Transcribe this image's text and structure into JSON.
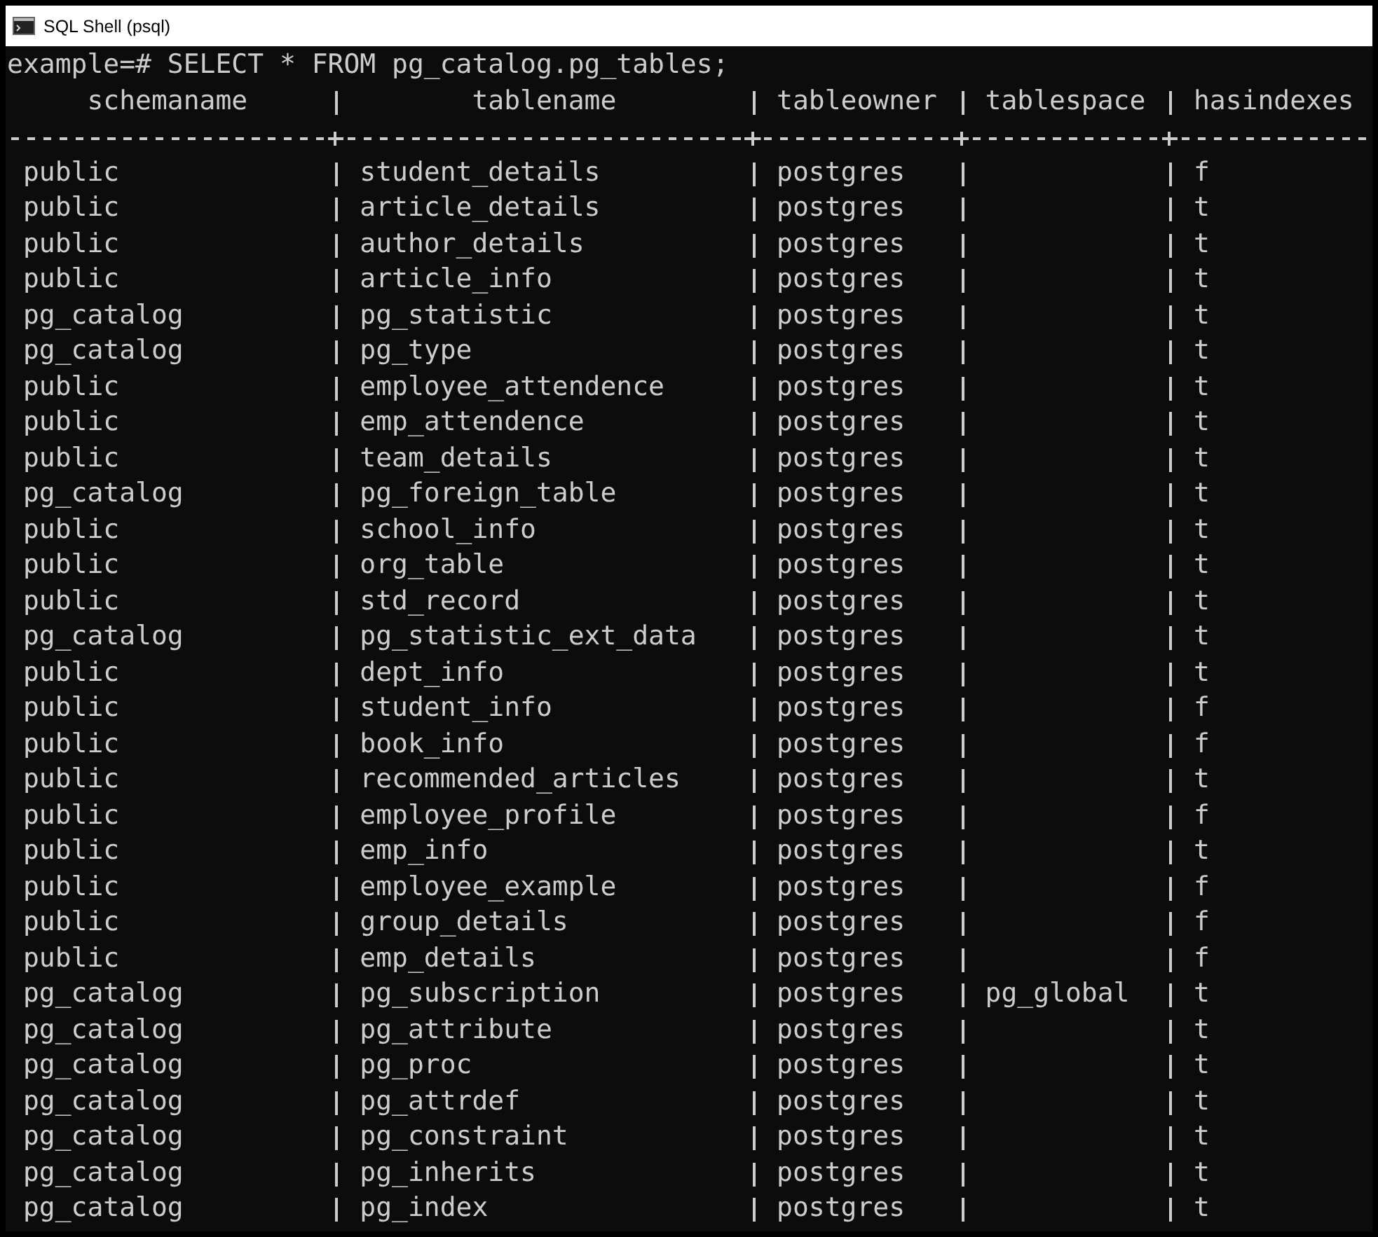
{
  "window": {
    "title": "SQL Shell (psql)"
  },
  "terminal": {
    "command_line": "example=# SELECT * FROM pg_catalog.pg_tables;",
    "columns": [
      "schemaname",
      "tablename",
      "tableowner",
      "tablespace",
      "hasindexes"
    ],
    "rows": [
      [
        "public",
        "student_details",
        "postgres",
        "",
        "f"
      ],
      [
        "public",
        "article_details",
        "postgres",
        "",
        "t"
      ],
      [
        "public",
        "author_details",
        "postgres",
        "",
        "t"
      ],
      [
        "public",
        "article_info",
        "postgres",
        "",
        "t"
      ],
      [
        "pg_catalog",
        "pg_statistic",
        "postgres",
        "",
        "t"
      ],
      [
        "pg_catalog",
        "pg_type",
        "postgres",
        "",
        "t"
      ],
      [
        "public",
        "employee_attendence",
        "postgres",
        "",
        "t"
      ],
      [
        "public",
        "emp_attendence",
        "postgres",
        "",
        "t"
      ],
      [
        "public",
        "team_details",
        "postgres",
        "",
        "t"
      ],
      [
        "pg_catalog",
        "pg_foreign_table",
        "postgres",
        "",
        "t"
      ],
      [
        "public",
        "school_info",
        "postgres",
        "",
        "t"
      ],
      [
        "public",
        "org_table",
        "postgres",
        "",
        "t"
      ],
      [
        "public",
        "std_record",
        "postgres",
        "",
        "t"
      ],
      [
        "pg_catalog",
        "pg_statistic_ext_data",
        "postgres",
        "",
        "t"
      ],
      [
        "public",
        "dept_info",
        "postgres",
        "",
        "t"
      ],
      [
        "public",
        "student_info",
        "postgres",
        "",
        "f"
      ],
      [
        "public",
        "book_info",
        "postgres",
        "",
        "f"
      ],
      [
        "public",
        "recommended_articles",
        "postgres",
        "",
        "t"
      ],
      [
        "public",
        "employee_profile",
        "postgres",
        "",
        "f"
      ],
      [
        "public",
        "emp_info",
        "postgres",
        "",
        "t"
      ],
      [
        "public",
        "employee_example",
        "postgres",
        "",
        "f"
      ],
      [
        "public",
        "group_details",
        "postgres",
        "",
        "f"
      ],
      [
        "public",
        "emp_details",
        "postgres",
        "",
        "f"
      ],
      [
        "pg_catalog",
        "pg_subscription",
        "postgres",
        "pg_global",
        "t"
      ],
      [
        "pg_catalog",
        "pg_attribute",
        "postgres",
        "",
        "t"
      ],
      [
        "pg_catalog",
        "pg_proc",
        "postgres",
        "",
        "t"
      ],
      [
        "pg_catalog",
        "pg_attrdef",
        "postgres",
        "",
        "t"
      ],
      [
        "pg_catalog",
        "pg_constraint",
        "postgres",
        "",
        "t"
      ],
      [
        "pg_catalog",
        "pg_inherits",
        "postgres",
        "",
        "t"
      ],
      [
        "pg_catalog",
        "pg_index",
        "postgres",
        "",
        "t"
      ]
    ]
  }
}
